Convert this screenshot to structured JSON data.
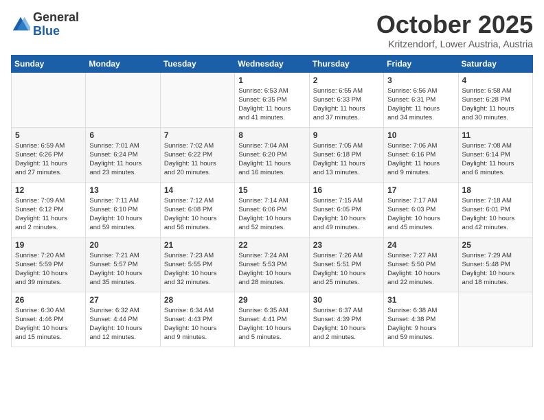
{
  "header": {
    "logo_general": "General",
    "logo_blue": "Blue",
    "title": "October 2025",
    "subtitle": "Kritzendorf, Lower Austria, Austria"
  },
  "weekdays": [
    "Sunday",
    "Monday",
    "Tuesday",
    "Wednesday",
    "Thursday",
    "Friday",
    "Saturday"
  ],
  "weeks": [
    [
      {
        "day": "",
        "info": ""
      },
      {
        "day": "",
        "info": ""
      },
      {
        "day": "",
        "info": ""
      },
      {
        "day": "1",
        "info": "Sunrise: 6:53 AM\nSunset: 6:35 PM\nDaylight: 11 hours\nand 41 minutes."
      },
      {
        "day": "2",
        "info": "Sunrise: 6:55 AM\nSunset: 6:33 PM\nDaylight: 11 hours\nand 37 minutes."
      },
      {
        "day": "3",
        "info": "Sunrise: 6:56 AM\nSunset: 6:31 PM\nDaylight: 11 hours\nand 34 minutes."
      },
      {
        "day": "4",
        "info": "Sunrise: 6:58 AM\nSunset: 6:28 PM\nDaylight: 11 hours\nand 30 minutes."
      }
    ],
    [
      {
        "day": "5",
        "info": "Sunrise: 6:59 AM\nSunset: 6:26 PM\nDaylight: 11 hours\nand 27 minutes."
      },
      {
        "day": "6",
        "info": "Sunrise: 7:01 AM\nSunset: 6:24 PM\nDaylight: 11 hours\nand 23 minutes."
      },
      {
        "day": "7",
        "info": "Sunrise: 7:02 AM\nSunset: 6:22 PM\nDaylight: 11 hours\nand 20 minutes."
      },
      {
        "day": "8",
        "info": "Sunrise: 7:04 AM\nSunset: 6:20 PM\nDaylight: 11 hours\nand 16 minutes."
      },
      {
        "day": "9",
        "info": "Sunrise: 7:05 AM\nSunset: 6:18 PM\nDaylight: 11 hours\nand 13 minutes."
      },
      {
        "day": "10",
        "info": "Sunrise: 7:06 AM\nSunset: 6:16 PM\nDaylight: 11 hours\nand 9 minutes."
      },
      {
        "day": "11",
        "info": "Sunrise: 7:08 AM\nSunset: 6:14 PM\nDaylight: 11 hours\nand 6 minutes."
      }
    ],
    [
      {
        "day": "12",
        "info": "Sunrise: 7:09 AM\nSunset: 6:12 PM\nDaylight: 11 hours\nand 2 minutes."
      },
      {
        "day": "13",
        "info": "Sunrise: 7:11 AM\nSunset: 6:10 PM\nDaylight: 10 hours\nand 59 minutes."
      },
      {
        "day": "14",
        "info": "Sunrise: 7:12 AM\nSunset: 6:08 PM\nDaylight: 10 hours\nand 56 minutes."
      },
      {
        "day": "15",
        "info": "Sunrise: 7:14 AM\nSunset: 6:06 PM\nDaylight: 10 hours\nand 52 minutes."
      },
      {
        "day": "16",
        "info": "Sunrise: 7:15 AM\nSunset: 6:05 PM\nDaylight: 10 hours\nand 49 minutes."
      },
      {
        "day": "17",
        "info": "Sunrise: 7:17 AM\nSunset: 6:03 PM\nDaylight: 10 hours\nand 45 minutes."
      },
      {
        "day": "18",
        "info": "Sunrise: 7:18 AM\nSunset: 6:01 PM\nDaylight: 10 hours\nand 42 minutes."
      }
    ],
    [
      {
        "day": "19",
        "info": "Sunrise: 7:20 AM\nSunset: 5:59 PM\nDaylight: 10 hours\nand 39 minutes."
      },
      {
        "day": "20",
        "info": "Sunrise: 7:21 AM\nSunset: 5:57 PM\nDaylight: 10 hours\nand 35 minutes."
      },
      {
        "day": "21",
        "info": "Sunrise: 7:23 AM\nSunset: 5:55 PM\nDaylight: 10 hours\nand 32 minutes."
      },
      {
        "day": "22",
        "info": "Sunrise: 7:24 AM\nSunset: 5:53 PM\nDaylight: 10 hours\nand 28 minutes."
      },
      {
        "day": "23",
        "info": "Sunrise: 7:26 AM\nSunset: 5:51 PM\nDaylight: 10 hours\nand 25 minutes."
      },
      {
        "day": "24",
        "info": "Sunrise: 7:27 AM\nSunset: 5:50 PM\nDaylight: 10 hours\nand 22 minutes."
      },
      {
        "day": "25",
        "info": "Sunrise: 7:29 AM\nSunset: 5:48 PM\nDaylight: 10 hours\nand 18 minutes."
      }
    ],
    [
      {
        "day": "26",
        "info": "Sunrise: 6:30 AM\nSunset: 4:46 PM\nDaylight: 10 hours\nand 15 minutes."
      },
      {
        "day": "27",
        "info": "Sunrise: 6:32 AM\nSunset: 4:44 PM\nDaylight: 10 hours\nand 12 minutes."
      },
      {
        "day": "28",
        "info": "Sunrise: 6:34 AM\nSunset: 4:43 PM\nDaylight: 10 hours\nand 9 minutes."
      },
      {
        "day": "29",
        "info": "Sunrise: 6:35 AM\nSunset: 4:41 PM\nDaylight: 10 hours\nand 5 minutes."
      },
      {
        "day": "30",
        "info": "Sunrise: 6:37 AM\nSunset: 4:39 PM\nDaylight: 10 hours\nand 2 minutes."
      },
      {
        "day": "31",
        "info": "Sunrise: 6:38 AM\nSunset: 4:38 PM\nDaylight: 9 hours\nand 59 minutes."
      },
      {
        "day": "",
        "info": ""
      }
    ]
  ]
}
